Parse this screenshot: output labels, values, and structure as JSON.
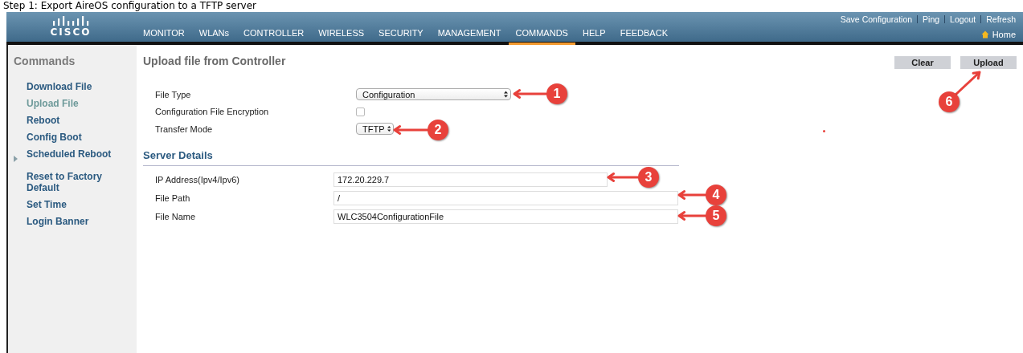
{
  "caption": "Step 1: Export AireOS configuration to a TFTP server",
  "header": {
    "logo_text": "CISCO",
    "top_links": [
      "Save Configuration",
      "Ping",
      "Logout",
      "Refresh"
    ],
    "nav": [
      {
        "label": "MONITOR",
        "selected": false
      },
      {
        "label": "WLANs",
        "selected": false
      },
      {
        "label": "CONTROLLER",
        "selected": false
      },
      {
        "label": "WIRELESS",
        "selected": false
      },
      {
        "label": "SECURITY",
        "selected": false
      },
      {
        "label": "MANAGEMENT",
        "selected": false
      },
      {
        "label": "COMMANDS",
        "selected": true
      },
      {
        "label": "HELP",
        "selected": false
      },
      {
        "label": "FEEDBACK",
        "selected": false
      }
    ],
    "home_link": "Home"
  },
  "sidebar": {
    "title": "Commands",
    "items": [
      {
        "label": "Download File",
        "selected": false,
        "kind": "link"
      },
      {
        "label": "Upload File",
        "selected": true,
        "kind": "link"
      },
      {
        "label": "Reboot",
        "selected": false,
        "kind": "link"
      },
      {
        "label": "Config Boot",
        "selected": false,
        "kind": "link"
      },
      {
        "label": "Scheduled Reboot",
        "selected": false,
        "kind": "group"
      },
      {
        "label": "Reset to Factory Default",
        "selected": false,
        "kind": "link"
      },
      {
        "label": "Set Time",
        "selected": false,
        "kind": "link"
      },
      {
        "label": "Login Banner",
        "selected": false,
        "kind": "link"
      }
    ]
  },
  "page": {
    "title": "Upload file from Controller",
    "buttons": [
      "Clear",
      "Upload"
    ],
    "fields": [
      {
        "label": "File Type",
        "kind": "select",
        "value": "Configuration"
      },
      {
        "label": "Configuration File Encryption",
        "kind": "checkbox",
        "checked": false
      },
      {
        "label": "Transfer Mode",
        "kind": "select",
        "value": "TFTP"
      }
    ],
    "server_details": {
      "title": "Server Details",
      "fields": [
        {
          "label": "IP Address(Ipv4/Ipv6)",
          "value": "172.20.229.7"
        },
        {
          "label": "File Path",
          "value": "/"
        },
        {
          "label": "File Name",
          "value": "WLC3504ConfigurationFile"
        }
      ]
    }
  },
  "callouts": [
    {
      "label": "1"
    },
    {
      "label": "2"
    },
    {
      "label": "3"
    },
    {
      "label": "4"
    },
    {
      "label": "5"
    },
    {
      "label": "6"
    }
  ]
}
